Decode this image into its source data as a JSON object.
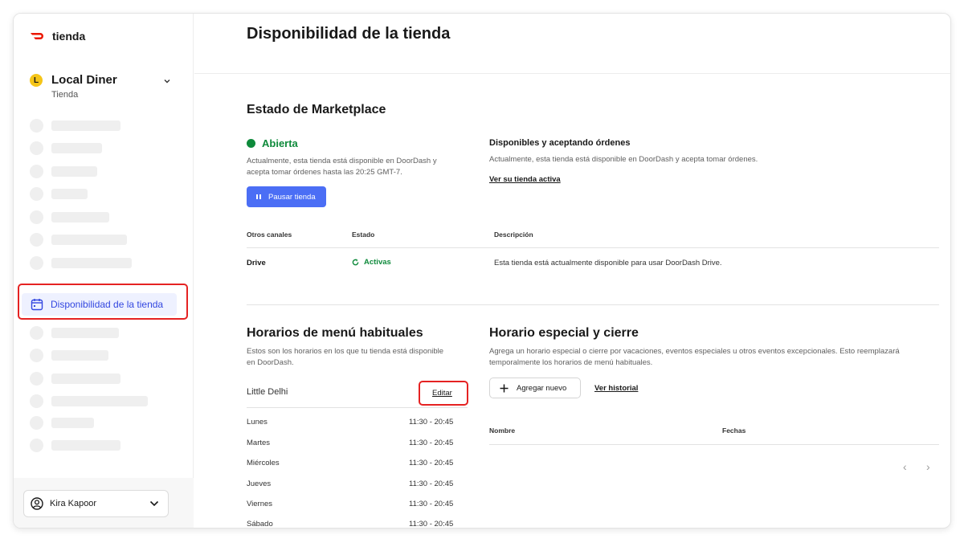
{
  "brand": {
    "name": "tienda"
  },
  "store": {
    "initial": "L",
    "name": "Local Diner",
    "type": "Tienda"
  },
  "nav": {
    "active_label": "Disponibilidad de la tienda"
  },
  "user": {
    "name": "Kira Kapoor"
  },
  "page": {
    "title": "Disponibilidad de la tienda"
  },
  "marketplace": {
    "title": "Estado de Marketplace",
    "status": "Abierta",
    "status_desc": "Actualmente, esta tienda está disponible en DoorDash y acepta tomar órdenes hasta las 20:25 GMT-7.",
    "pause_label": "Pausar tienda",
    "right_title": "Disponibles y aceptando órdenes",
    "right_desc": "Actualmente, esta tienda está disponible en DoorDash y acepta tomar órdenes.",
    "right_link": "Ver su tienda activa"
  },
  "channels": {
    "headers": [
      "Otros canales",
      "Estado",
      "Descripción"
    ],
    "rows": [
      {
        "name": "Drive",
        "status": "Activas",
        "desc": "Esta tienda está actualmente disponible para usar DoorDash Drive."
      }
    ]
  },
  "menu_hours": {
    "title": "Horarios de menú habituales",
    "desc": "Estos son los horarios en los que tu tienda está disponible en DoorDash.",
    "menu_name": "Little Delhi",
    "edit_label": "Editar",
    "days": [
      {
        "day": "Lunes",
        "hours": "11:30 - 20:45"
      },
      {
        "day": "Martes",
        "hours": "11:30 - 20:45"
      },
      {
        "day": "Miércoles",
        "hours": "11:30 - 20:45"
      },
      {
        "day": "Jueves",
        "hours": "11:30 - 20:45"
      },
      {
        "day": "Viernes",
        "hours": "11:30 - 20:45"
      },
      {
        "day": "Sábado",
        "hours": "11:30 - 20:45"
      }
    ]
  },
  "special_hours": {
    "title": "Horario especial y cierre",
    "desc": "Agrega un horario especial o cierre por vacaciones, eventos especiales u otros eventos excepcionales. Esto reemplazará temporalmente los horarios de menú habituales.",
    "add_label": "Agregar nuevo",
    "history_label": "Ver historial",
    "headers": [
      "Nombre",
      "Fechas"
    ]
  },
  "colors": {
    "accent": "#4b6ef5",
    "open": "#0e8a3b",
    "brand": "#eb1700",
    "highlight": "#e52222"
  },
  "icons": {
    "brand": "doordash-logo-icon",
    "nav": "calendar-icon",
    "pause": "pause-icon",
    "drive": "refresh-icon",
    "user": "user-circle-icon",
    "add": "plus-icon"
  }
}
